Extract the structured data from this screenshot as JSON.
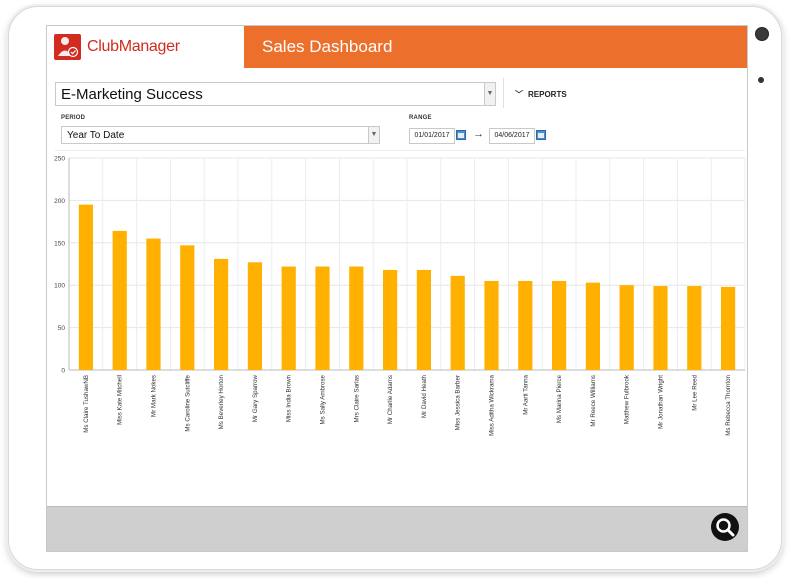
{
  "app": {
    "brand": "ClubManager",
    "title": "Sales Dashboard"
  },
  "report": {
    "selected": "E-Marketing Success",
    "reports_label": "REPORTS"
  },
  "filters": {
    "period_label": "PERIOD",
    "period_value": "Year To Date",
    "range_label": "RANGE",
    "range_from": "01/01/2017",
    "range_to": "04/06/2017",
    "range_arrow": "→"
  },
  "chart_data": {
    "type": "bar",
    "categories": [
      "Ms Claire TushawNB",
      "Miss Kate Mitchell",
      "Mr Mark Nokes",
      "Ms Caroline Sutcliffe",
      "Ms Beverley Horton",
      "Mr Gary Sparrow",
      "Miss India Brown",
      "Ms Sally Ambrose",
      "Mrs Claire Sarlas",
      "Mr Charlie Adams",
      "Mr David Heath",
      "Miss Jessica Barber",
      "Miss Aditha Wickrama",
      "Mr Aarti Tanna",
      "Ms Marina Pierce",
      "Mr Reece Williams",
      "Matthew Fulbrook",
      "Mr Jonathan Wright",
      "Mr Lee Reed",
      "Ms Rebecca Thornton"
    ],
    "values": [
      195,
      164,
      155,
      147,
      131,
      127,
      122,
      122,
      122,
      118,
      118,
      111,
      105,
      105,
      105,
      103,
      100,
      99,
      99,
      98
    ],
    "ylim": [
      0,
      250
    ],
    "yticks": [
      0,
      50,
      100,
      150,
      200,
      250
    ],
    "bar_color": "#ffb000",
    "grid": true
  }
}
